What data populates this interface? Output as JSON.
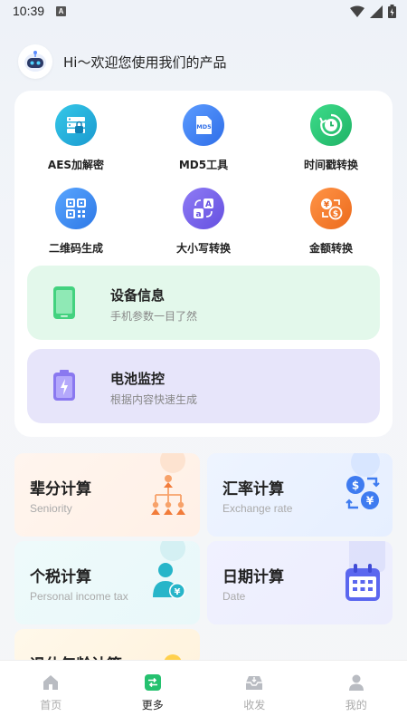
{
  "status_bar": {
    "time": "10:39"
  },
  "greeting": {
    "text": "Hi～欢迎您使用我们的产品"
  },
  "tools": [
    {
      "label": "AES加解密",
      "icon": "server-lock-icon",
      "color": "#1fb2d6"
    },
    {
      "label": "MD5工具",
      "icon": "md5-file-icon",
      "color": "#3d7df2"
    },
    {
      "label": "时间戳转换",
      "icon": "clock-refresh-icon",
      "color": "#2cc56f"
    },
    {
      "label": "二维码生成",
      "icon": "qr-code-icon",
      "color": "#3f8df0"
    },
    {
      "label": "大小写转换",
      "icon": "letter-case-icon",
      "color": "#7a67e8"
    },
    {
      "label": "金额转换",
      "icon": "currency-exchange-icon",
      "color": "#f07a2a"
    }
  ],
  "banners": [
    {
      "title": "设备信息",
      "subtitle": "手机参数一目了然",
      "icon": "phone-icon",
      "bg": "#e2f7ea"
    },
    {
      "title": "电池监控",
      "subtitle": "根据内容快速生成",
      "icon": "battery-icon",
      "bg": "#e7e5f9"
    }
  ],
  "calculators": [
    {
      "title": "辈分计算",
      "subtitle": "Seniority",
      "icon": "family-tree-icon"
    },
    {
      "title": "汇率计算",
      "subtitle": "Exchange rate",
      "icon": "exchange-rate-icon"
    },
    {
      "title": "个税计算",
      "subtitle": "Personal income tax",
      "icon": "person-tax-icon"
    },
    {
      "title": "日期计算",
      "subtitle": "Date",
      "icon": "calendar-icon"
    },
    {
      "title": "退休年龄计算",
      "subtitle": "",
      "icon": "retirement-icon"
    }
  ],
  "bottom_nav": [
    {
      "label": "首页",
      "icon": "home-icon",
      "active": false
    },
    {
      "label": "更多",
      "icon": "more-icon",
      "active": true
    },
    {
      "label": "收发",
      "icon": "inbox-icon",
      "active": false
    },
    {
      "label": "我的",
      "icon": "user-icon",
      "active": false
    }
  ]
}
